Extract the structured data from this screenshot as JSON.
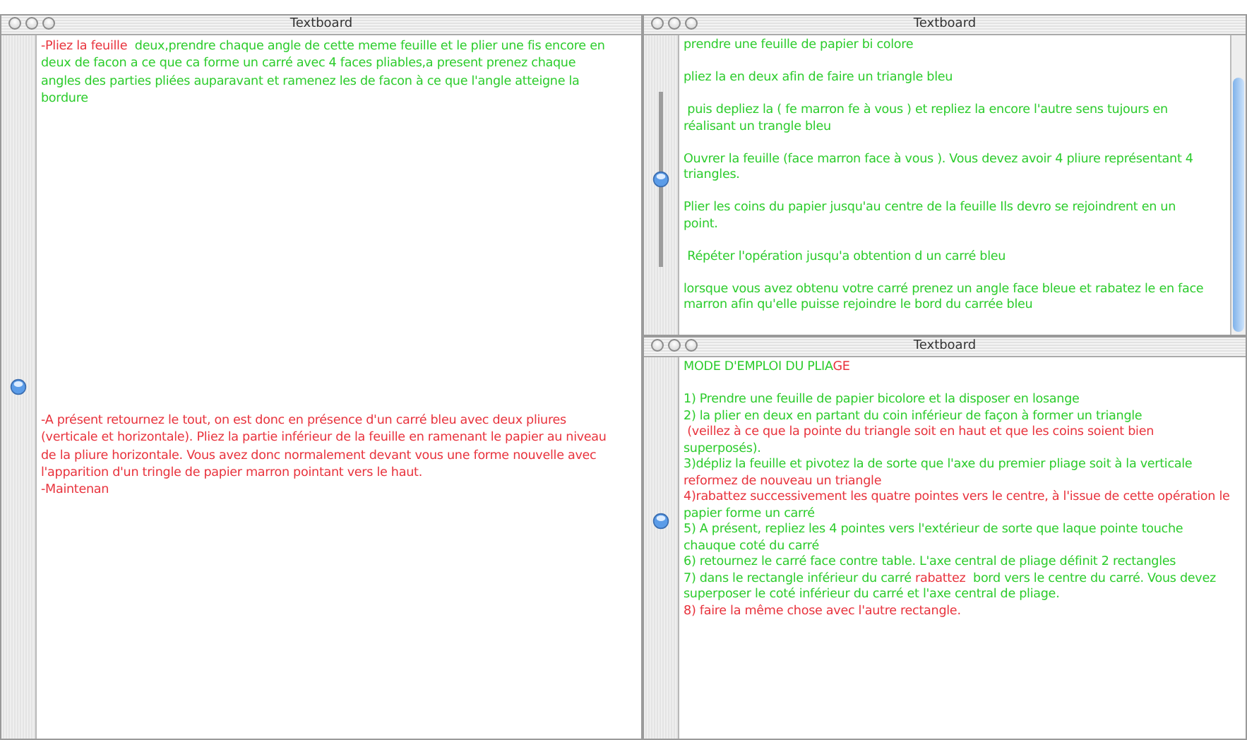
{
  "windows": [
    {
      "title": "Textboard",
      "kind": "split",
      "paragraphs": [
        [
          [
            {
              "text": "-Pliez la feuille  ",
              "color": "#e8323c"
            },
            {
              "text": "deux,prendre chaque angle de cette meme feuille et le plier une fis encore en",
              "color": "#2ccc2c"
            }
          ],
          [
            {
              "text": "deux de facon a ce que ca forme un carré avec 4 faces pliables,a present prenez chaque",
              "color": "#2ccc2c"
            }
          ],
          [
            {
              "text": "angles des parties pliées auparavant et ramenez les de facon à ce que l'angle atteigne la",
              "color": "#2ccc2c"
            }
          ],
          [
            {
              "text": "bordure",
              "color": "#2ccc2c"
            }
          ]
        ],
        [
          [
            {
              "text": "-A présent retournez le tout, on est donc en présence d'un carré bleu avec deux pliures",
              "color": "#e8323c"
            }
          ],
          [
            {
              "text": "(verticale et horizontale). Pliez la partie inférieur de la feuille en ramenant le papier au niveau",
              "color": "#e8323c"
            }
          ],
          [
            {
              "text": "de la pliure horizontale. Vous avez donc normalement devant vous une forme nouvelle avec",
              "color": "#e8323c"
            }
          ],
          [
            {
              "text": "l'apparition d'un tringle de papier marron pointant vers le haut.",
              "color": "#e8323c"
            }
          ],
          [
            {
              "text": "-Maintenan",
              "color": "#e8323c"
            }
          ]
        ]
      ]
    },
    {
      "title": "Textboard",
      "kind": "list",
      "slider": {
        "level": 0.5
      },
      "paragraphs": [
        [
          [
            {
              "text": "prendre une feuille de papier bi colore",
              "color": "#2ccc2c"
            }
          ]
        ],
        [
          [
            {
              "text": "pliez la en deux afin de faire un triangle bleu",
              "color": "#2ccc2c"
            }
          ]
        ],
        [
          [
            {
              "text": " puis depliez la ( fe marron fe à vous ) et repliez la encore l'autre sens tujours en",
              "color": "#2ccc2c"
            }
          ],
          [
            {
              "text": "réalisant un trangle bleu",
              "color": "#2ccc2c"
            }
          ]
        ],
        [
          [
            {
              "text": "Ouvrer la feuille (face marron face à vous ). Vous devez avoir 4 pliure représentant 4",
              "color": "#2ccc2c"
            }
          ],
          [
            {
              "text": "triangles.",
              "color": "#2ccc2c"
            }
          ]
        ],
        [
          [
            {
              "text": "Plier les coins du papier jusqu'au centre de la feuille Ils devro se rejoindrent en un",
              "color": "#2ccc2c"
            }
          ],
          [
            {
              "text": "point.",
              "color": "#2ccc2c"
            }
          ]
        ],
        [
          [
            {
              "text": " Répéter l'opération jusqu'a obtention d un carré bleu",
              "color": "#2ccc2c"
            }
          ]
        ],
        [
          [
            {
              "text": "lorsque vous avez obtenu votre carré prenez un angle face bleue et rabatez le en face",
              "color": "#2ccc2c"
            }
          ],
          [
            {
              "text": "marron afin qu'elle puisse rejoindre le bord du carrée bleu",
              "color": "#2ccc2c"
            }
          ]
        ]
      ]
    },
    {
      "title": "Textboard",
      "kind": "list",
      "paragraphs": [
        [
          [
            {
              "text": "MODE D'EMPLOI DU PLIA",
              "color": "#2ccc2c"
            },
            {
              "text": "GE",
              "color": "#e8323c"
            }
          ]
        ],
        [
          [
            {
              "text": "1) Prendre une feuille de papier bicolore et la disposer en losange",
              "color": "#2ccc2c"
            }
          ],
          [
            {
              "text": "2) la plier en deux en partant du coin inférieur de façon à former un triangle",
              "color": "#2ccc2c"
            }
          ],
          [
            {
              "text": " (veillez à ce que la pointe du triangle soit en haut et que les coins soient bien",
              "color": "#e8323c"
            }
          ],
          [
            {
              "text": "superposés).",
              "color": "#2ccc2c"
            }
          ],
          [
            {
              "text": "3)dépliz la feuille et pivotez la de sorte que l'axe du premier pliage soit à la verticale",
              "color": "#2ccc2c"
            }
          ],
          [
            {
              "text": "reformez de nouveau un triangle",
              "color": "#e8323c"
            }
          ],
          [
            {
              "text": "4)rabattez successivement les quatre pointes vers le centre, à l'issue de cette opération le",
              "color": "#e8323c"
            }
          ],
          [
            {
              "text": "papier forme un carré",
              "color": "#2ccc2c"
            }
          ],
          [
            {
              "text": "5) A présent, repliez les 4 pointes vers l'extérieur de sorte que laque pointe touche",
              "color": "#2ccc2c"
            }
          ],
          [
            {
              "text": "chauque coté du carré",
              "color": "#2ccc2c"
            }
          ],
          [
            {
              "text": "6) retournez le carré face contre table. L'axe central de pliage définit 2 rectangles",
              "color": "#2ccc2c"
            }
          ],
          [
            {
              "text": "7) dans le rectangle inférieur du carré ",
              "color": "#2ccc2c"
            },
            {
              "text": "rabattez ",
              "color": "#e8323c"
            },
            {
              "text": " bord vers le centre du carré. Vous devez",
              "color": "#2ccc2c"
            }
          ],
          [
            {
              "text": "superposer le coté inférieur du carré et l'axe central de pliage.",
              "color": "#2ccc2c"
            }
          ],
          [
            {
              "text": "8) faire la même chose avec l'autre rectangle.",
              "color": "#e8323c"
            }
          ]
        ]
      ]
    }
  ]
}
